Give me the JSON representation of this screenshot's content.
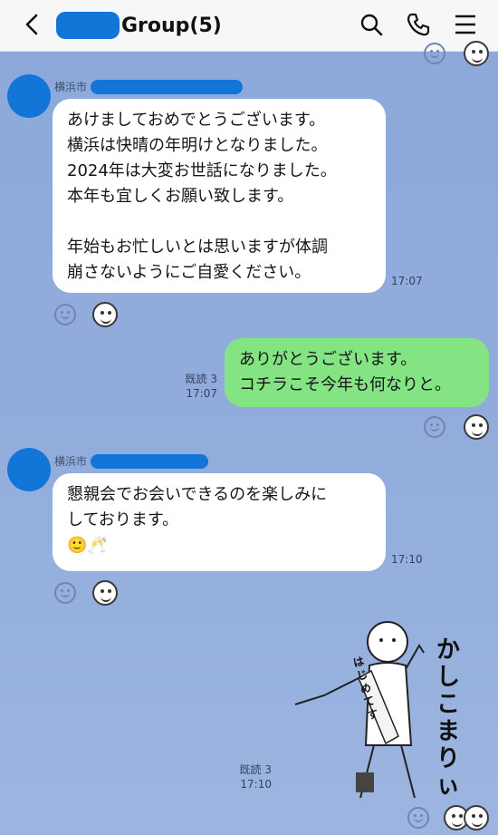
{
  "header": {
    "title": "Group(5)",
    "icons": [
      "back-icon",
      "search-icon",
      "phone-icon",
      "menu-icon"
    ]
  },
  "messages": [
    {
      "sender": "横浜市",
      "lines": [
        "あけましておめでとうございます。",
        "横浜は快晴の年明けとなりました。",
        "2024年は大変お世話になりました。",
        "本年も宜しくお願い致します。",
        "",
        "年始もお忙しいとは思いますが体調",
        "崩さないようにご自愛ください。"
      ],
      "time": "17:07"
    },
    {
      "lines": [
        "ありがとうございます。",
        "コチラこそ今年も何なりと。"
      ],
      "read": "既読 3",
      "time": "17:07"
    },
    {
      "sender": "横浜市",
      "lines": [
        "懇親会でお会いできるのを楽しみに",
        "しております。"
      ],
      "emoji": "🙂🥂",
      "time": "17:10"
    },
    {
      "sticker_text_vertical": "はじめてす",
      "sticker_text_side": "かしこまりぃ",
      "read": "既読 3",
      "time": "17:10"
    }
  ],
  "colors": {
    "header_bg": "#f7f7f7",
    "chat_bg": "#8da9db",
    "my_bubble": "#84e383",
    "their_bubble": "#ffffff",
    "redaction": "#1275d8"
  }
}
